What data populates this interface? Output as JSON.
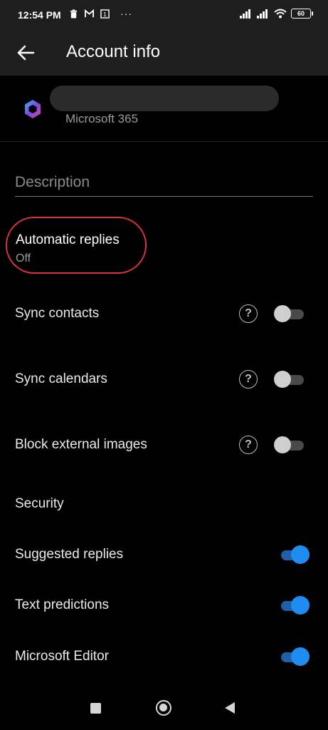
{
  "status_bar": {
    "time": "12:54 PM",
    "battery": "60",
    "left_icons": [
      "trash-icon",
      "gmail-icon",
      "calendar-1-icon"
    ],
    "right_icons": [
      "signal-icon",
      "signal-icon",
      "wifi-icon",
      "battery-icon"
    ],
    "overflow": "···"
  },
  "app_bar": {
    "title": "Account info",
    "back_icon": "arrow-left-icon"
  },
  "account": {
    "type": "Microsoft 365",
    "logo_icon": "microsoft-365-logo"
  },
  "description": {
    "placeholder": "Description"
  },
  "automatic_replies": {
    "label": "Automatic replies",
    "status": "Off"
  },
  "sync_rows": [
    {
      "label": "Sync contacts",
      "enabled": false
    },
    {
      "label": "Sync calendars",
      "enabled": false
    },
    {
      "label": "Block external images",
      "enabled": false
    }
  ],
  "security": {
    "header": "Security",
    "rows": [
      {
        "label": "Suggested replies",
        "enabled": true
      },
      {
        "label": "Text predictions",
        "enabled": true
      },
      {
        "label": "Microsoft Editor",
        "enabled": true
      }
    ]
  },
  "colors": {
    "accent": "#1e8cf0",
    "highlight_ring": "#d9333f",
    "bar_bg": "#1e1e1e"
  },
  "nav_bar": {
    "icons": [
      "recents-square-icon",
      "home-circle-icon",
      "back-triangle-icon"
    ]
  }
}
